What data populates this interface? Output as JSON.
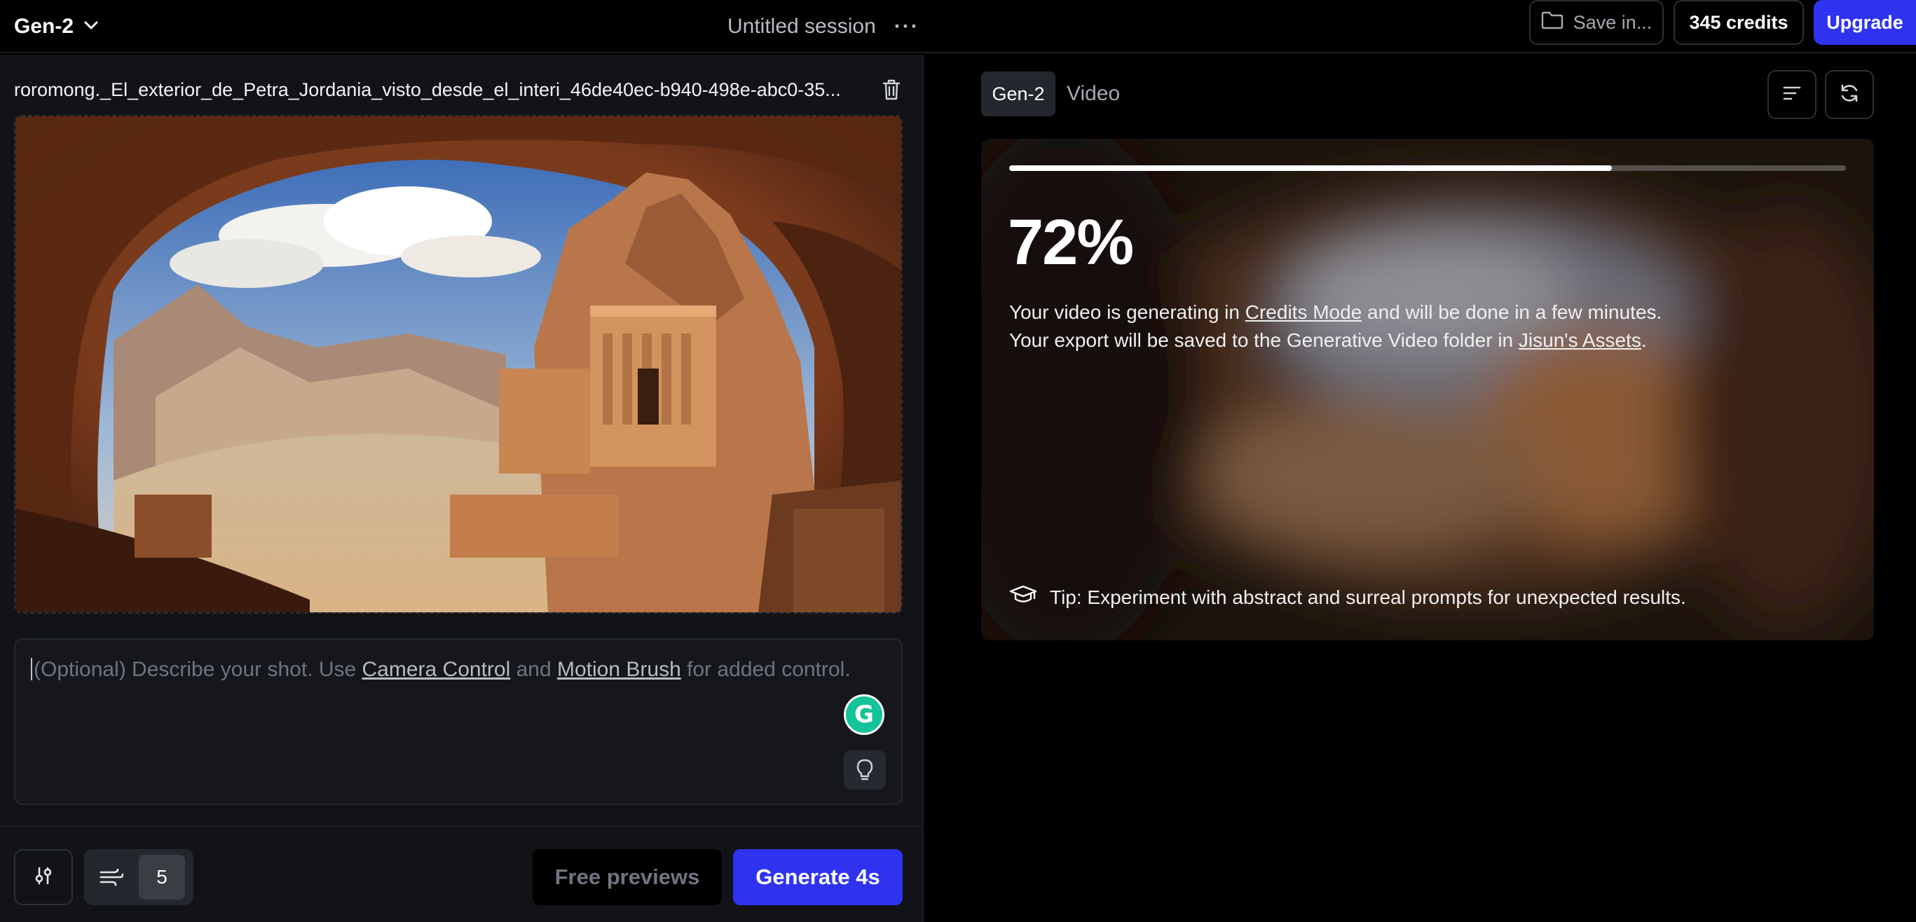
{
  "header": {
    "model_label": "Gen-2",
    "session_title": "Untitled session",
    "more_glyph": "···",
    "save_label": "Save in...",
    "credits_label": "345 credits",
    "upgrade_label": "Upgrade"
  },
  "left_panel": {
    "filename": "roromong._El_exterior_de_Petra_Jordania_visto_desde_el_interi_46de40ec-b940-498e-abc0-35...",
    "prompt": {
      "placeholder_start": "(Optional) Describe your shot. Use ",
      "camera_control_link": "Camera Control",
      "joiner": " and ",
      "motion_brush_link": "Motion Brush",
      "placeholder_end": " for added control."
    },
    "motion_value": "5",
    "free_previews_label": "Free previews",
    "generate_label": "Generate 4s"
  },
  "right_panel": {
    "tab_model": "Gen-2",
    "tab_video": "Video",
    "generation": {
      "progress": 0.72,
      "percent_label": "72%",
      "line1_start": "Your video is generating in ",
      "credits_mode_link": "Credits Mode",
      "line1_end": " and will be done in a few minutes.",
      "line2_start": "Your export will be saved to the Generative Video folder in ",
      "assets_link": "Jisun's Assets",
      "line2_end": ".",
      "tip": "Tip: Experiment with abstract and surreal prompts for unexpected results."
    }
  },
  "colors": {
    "accent": "#2f33f0",
    "panel_bg": "#111317",
    "app_bg": "#000000",
    "grammarly": "#15c39a"
  },
  "icons": [
    "chevron-down-icon",
    "folder-icon",
    "trash-icon",
    "grammarly-icon",
    "lightbulb-icon",
    "settings-sliders-icon",
    "motion-wind-icon",
    "list-icon",
    "refresh-icon",
    "graduation-cap-icon"
  ]
}
